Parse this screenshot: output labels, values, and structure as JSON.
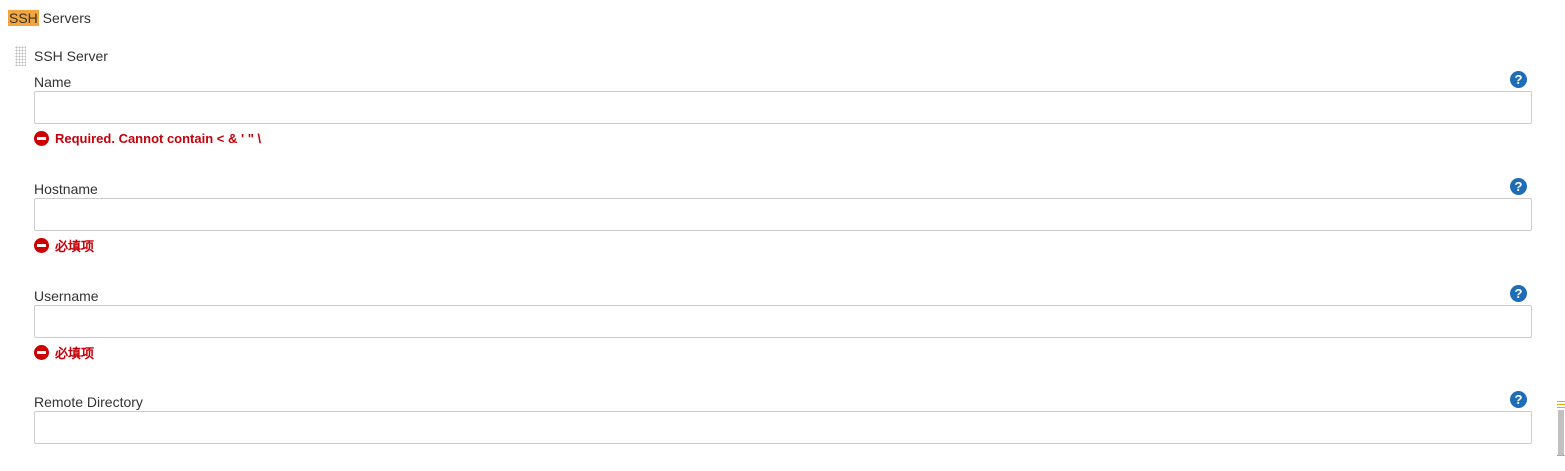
{
  "section": {
    "title_highlight": "SSH",
    "title_rest": " Servers"
  },
  "block": {
    "title": "SSH Server"
  },
  "fields": {
    "name": {
      "label": "Name",
      "value": "",
      "help": "?",
      "error": "Required. Cannot contain < & ' \" \\"
    },
    "hostname": {
      "label": "Hostname",
      "value": "",
      "help": "?",
      "error": "必填项"
    },
    "username": {
      "label": "Username",
      "value": "",
      "help": "?",
      "error": "必填项"
    },
    "remote_directory": {
      "label": "Remote Directory",
      "value": "",
      "help": "?"
    }
  },
  "colors": {
    "highlight": "#f3a53d",
    "error": "#c4000a",
    "help_icon": "#1f6db5"
  }
}
